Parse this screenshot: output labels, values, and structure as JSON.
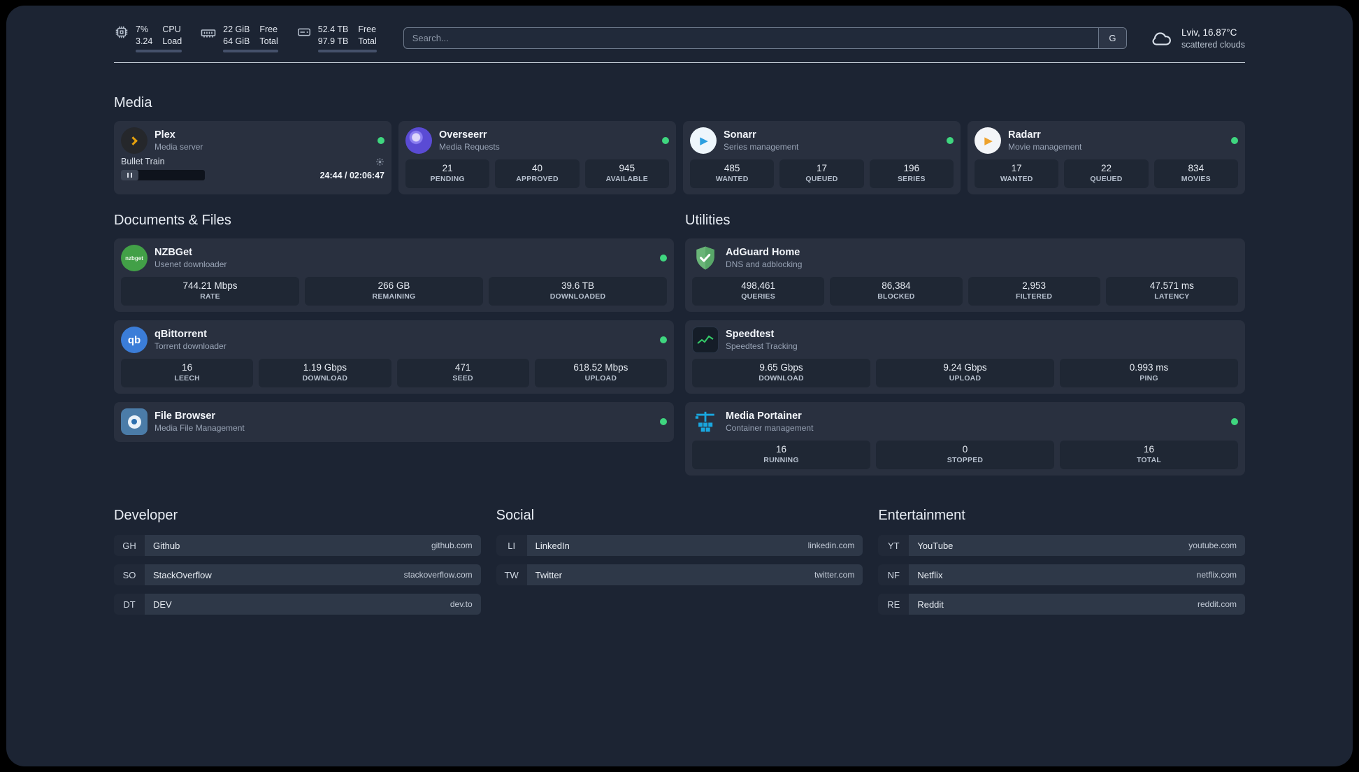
{
  "topbar": {
    "cpu": {
      "value_top": "7%",
      "value_bottom": "3.24",
      "label_top": "CPU",
      "label_bottom": "Load"
    },
    "memory": {
      "value_top": "22 GiB",
      "value_bottom": "64 GiB",
      "label_top": "Free",
      "label_bottom": "Total"
    },
    "disk": {
      "value_top": "52.4 TB",
      "value_bottom": "97.9 TB",
      "label_top": "Free",
      "label_bottom": "Total"
    },
    "search": {
      "placeholder": "Search...",
      "provider_label": "G"
    },
    "weather": {
      "location": "Lviv, 16.87°C",
      "condition": "scattered clouds"
    }
  },
  "sections": {
    "media": {
      "title": "Media",
      "plex": {
        "name": "Plex",
        "subtitle": "Media server",
        "now_playing_title": "Bullet Train",
        "time": "24:44 / 02:06:47"
      },
      "overseerr": {
        "name": "Overseerr",
        "subtitle": "Media Requests",
        "stats": [
          {
            "value": "21",
            "label": "PENDING"
          },
          {
            "value": "40",
            "label": "APPROVED"
          },
          {
            "value": "945",
            "label": "AVAILABLE"
          }
        ]
      },
      "sonarr": {
        "name": "Sonarr",
        "subtitle": "Series management",
        "stats": [
          {
            "value": "485",
            "label": "WANTED"
          },
          {
            "value": "17",
            "label": "QUEUED"
          },
          {
            "value": "196",
            "label": "SERIES"
          }
        ]
      },
      "radarr": {
        "name": "Radarr",
        "subtitle": "Movie management",
        "stats": [
          {
            "value": "17",
            "label": "WANTED"
          },
          {
            "value": "22",
            "label": "QUEUED"
          },
          {
            "value": "834",
            "label": "MOVIES"
          }
        ]
      }
    },
    "documents": {
      "title": "Documents & Files",
      "nzbget": {
        "name": "NZBGet",
        "subtitle": "Usenet downloader",
        "stats": [
          {
            "value": "744.21 Mbps",
            "label": "RATE"
          },
          {
            "value": "266 GB",
            "label": "REMAINING"
          },
          {
            "value": "39.6 TB",
            "label": "DOWNLOADED"
          }
        ]
      },
      "qbittorrent": {
        "name": "qBittorrent",
        "subtitle": "Torrent downloader",
        "stats": [
          {
            "value": "16",
            "label": "LEECH"
          },
          {
            "value": "1.19 Gbps",
            "label": "DOWNLOAD"
          },
          {
            "value": "471",
            "label": "SEED"
          },
          {
            "value": "618.52 Mbps",
            "label": "UPLOAD"
          }
        ]
      },
      "filebrowser": {
        "name": "File Browser",
        "subtitle": "Media File Management"
      }
    },
    "utilities": {
      "title": "Utilities",
      "adguard": {
        "name": "AdGuard Home",
        "subtitle": "DNS and adblocking",
        "stats": [
          {
            "value": "498,461",
            "label": "QUERIES"
          },
          {
            "value": "86,384",
            "label": "BLOCKED"
          },
          {
            "value": "2,953",
            "label": "FILTERED"
          },
          {
            "value": "47.571 ms",
            "label": "LATENCY"
          }
        ]
      },
      "speedtest": {
        "name": "Speedtest",
        "subtitle": "Speedtest Tracking",
        "stats": [
          {
            "value": "9.65 Gbps",
            "label": "DOWNLOAD"
          },
          {
            "value": "9.24 Gbps",
            "label": "UPLOAD"
          },
          {
            "value": "0.993 ms",
            "label": "PING"
          }
        ]
      },
      "portainer": {
        "name": "Media Portainer",
        "subtitle": "Container management",
        "stats": [
          {
            "value": "16",
            "label": "RUNNING"
          },
          {
            "value": "0",
            "label": "STOPPED"
          },
          {
            "value": "16",
            "label": "TOTAL"
          }
        ]
      }
    }
  },
  "bookmarks": {
    "developer": {
      "title": "Developer",
      "items": [
        {
          "abbr": "GH",
          "name": "Github",
          "domain": "github.com"
        },
        {
          "abbr": "SO",
          "name": "StackOverflow",
          "domain": "stackoverflow.com"
        },
        {
          "abbr": "DT",
          "name": "DEV",
          "domain": "dev.to"
        }
      ]
    },
    "social": {
      "title": "Social",
      "items": [
        {
          "abbr": "LI",
          "name": "LinkedIn",
          "domain": "linkedin.com"
        },
        {
          "abbr": "TW",
          "name": "Twitter",
          "domain": "twitter.com"
        }
      ]
    },
    "entertainment": {
      "title": "Entertainment",
      "items": [
        {
          "abbr": "YT",
          "name": "YouTube",
          "domain": "youtube.com"
        },
        {
          "abbr": "NF",
          "name": "Netflix",
          "domain": "netflix.com"
        },
        {
          "abbr": "RE",
          "name": "Reddit",
          "domain": "reddit.com"
        }
      ]
    }
  },
  "icons": {
    "nzbget_label": "nzbget",
    "qbittorrent_label": "qb"
  },
  "colors": {
    "status_green": "#3fd67f",
    "plex_amber": "#e5a00d",
    "background": "#1c2433",
    "card": "#29303f"
  }
}
